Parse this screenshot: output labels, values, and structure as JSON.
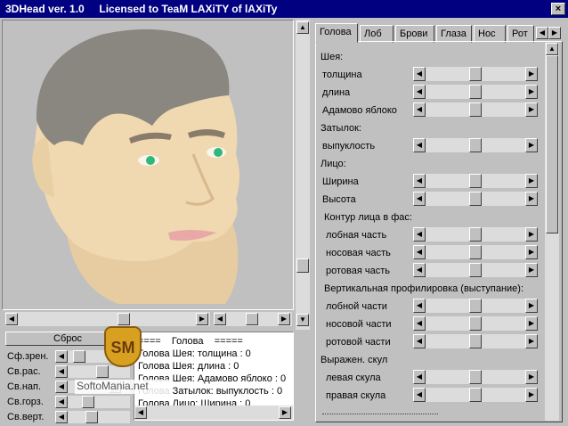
{
  "window": {
    "title": "3DHead ver. 1.0     Licensed to TeaM LAXiTY of lAXiTy",
    "close": "×"
  },
  "reset_label": "Сброс",
  "mini_labels": [
    "Сф.зрен.",
    "Св.рас.",
    "Св.нап.",
    "Св.горз.",
    "Св.верт."
  ],
  "log_lines": [
    "====    Голова    =====",
    "Голова Шея: толщина : 0",
    "Голова Шея: длина : 0",
    "Голова Шея: Адамово яблоко : 0",
    "Голова Затылок: выпуклость : 0",
    "Голова Лицо: Ширина : 0"
  ],
  "tabs": [
    "Голова",
    "Лоб",
    "Брови",
    "Глаза",
    "Нос",
    "Рот"
  ],
  "sections": {
    "neck": "Шея:",
    "nape": "Затылок:",
    "face": "Лицо:",
    "contour": "Контур лица в фас:",
    "profile": "Вертикальная профилировка (выступание):",
    "cheek": "Выражен. скул"
  },
  "params": [
    "толщина",
    "длина",
    "Адамово яблоко",
    "выпуклость",
    "Ширина",
    "Высота",
    "лобная часть",
    "носовая часть",
    "ротовая часть",
    "лобной части",
    "носовой части",
    "ротовой части",
    "левая скула",
    "правая скула"
  ],
  "watermark": {
    "badge": "SM",
    "text": "SoftoMania.net"
  },
  "colors": {
    "titlebar": "#000080",
    "face": "#f0d8b0",
    "hair": "#8a8680",
    "eyes": "#2fb87a"
  }
}
